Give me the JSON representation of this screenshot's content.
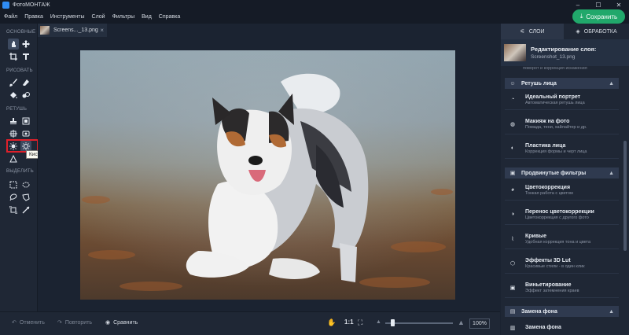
{
  "window": {
    "title": "ФотоМОНТАЖ",
    "controls": [
      "–",
      "☐",
      "✕"
    ]
  },
  "menu": [
    "Файл",
    "Правка",
    "Инструменты",
    "Слой",
    "Фильтры",
    "Вид",
    "Справка"
  ],
  "save_button": "Сохранить",
  "toolbar": {
    "sections": [
      "ОСНОВНЫЕ",
      "РИСОВАТЬ",
      "РЕТУШЬ",
      "ВЫДЕЛИТЬ"
    ],
    "tooltip": "Кисть затемнения"
  },
  "document_tab": {
    "name": "Screens..._13.png",
    "close": "×"
  },
  "bottom_bar": {
    "undo": "Отменить",
    "redo": "Повторить",
    "compare": "Сравнить",
    "actual_size": "1:1",
    "zoom": "100%",
    "zoom_slider_fraction": 0.1
  },
  "right_panel": {
    "tabs": [
      "СЛОИ",
      "ОБРАБОТКА"
    ],
    "layer": {
      "title": "Редактирование слоя:",
      "file": "Screenshot_13.png"
    },
    "cut_text": "поворот и коррекция искажения",
    "sections": [
      {
        "title": "Ретушь лица",
        "items": [
          {
            "title": "Идеальный портрет",
            "subtitle": "Автоматическая ретушь лица"
          },
          {
            "title": "Макияж на фото",
            "subtitle": "Помада, тени, хайлайтер и др."
          },
          {
            "title": "Пластика лица",
            "subtitle": "Коррекция формы и черт лица"
          }
        ]
      },
      {
        "title": "Продвинутые фильтры",
        "items": [
          {
            "title": "Цветокоррекция",
            "subtitle": "Тонкая работа с цветом"
          },
          {
            "title": "Перенос цветокоррекции",
            "subtitle": "Цветокоррекция с другого фото"
          },
          {
            "title": "Кривые",
            "subtitle": "Удобная коррекция тона и цвета"
          },
          {
            "title": "Эффекты 3D Lut",
            "subtitle": "Красивые стили - в один клик"
          },
          {
            "title": "Виньетирование",
            "subtitle": "Эффект затемнения краев"
          }
        ]
      },
      {
        "title": "Замена фона",
        "items": [
          {
            "title": "Замена фона",
            "subtitle": ""
          }
        ]
      }
    ]
  },
  "colors": {
    "accent": "#21a86b",
    "highlight": "#e0202a",
    "panel": "#1f2735",
    "background": "#1b2331"
  }
}
